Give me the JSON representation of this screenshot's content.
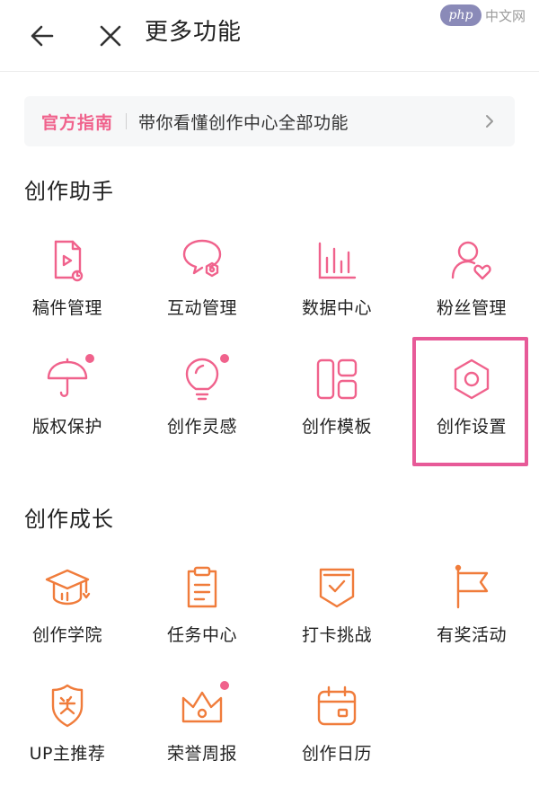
{
  "header": {
    "title": "更多功能"
  },
  "watermark": {
    "logo": "php",
    "text": "中文网"
  },
  "guide": {
    "tag": "官方指南",
    "text": "带你看懂创作中心全部功能"
  },
  "colors": {
    "pink": "#f0628c",
    "orange": "#f07c3b",
    "highlight": "#e75a98"
  },
  "sections": [
    {
      "title": "创作助手",
      "items": [
        {
          "label": "稿件管理",
          "icon": "manuscript-icon",
          "dot": false
        },
        {
          "label": "互动管理",
          "icon": "interaction-icon",
          "dot": false
        },
        {
          "label": "数据中心",
          "icon": "data-chart-icon",
          "dot": false
        },
        {
          "label": "粉丝管理",
          "icon": "fans-icon",
          "dot": false
        },
        {
          "label": "版权保护",
          "icon": "umbrella-icon",
          "dot": true
        },
        {
          "label": "创作灵感",
          "icon": "lightbulb-icon",
          "dot": true
        },
        {
          "label": "创作模板",
          "icon": "template-icon",
          "dot": false
        },
        {
          "label": "创作设置",
          "icon": "settings-hexagon-icon",
          "dot": false
        }
      ]
    },
    {
      "title": "创作成长",
      "items": [
        {
          "label": "创作学院",
          "icon": "graduation-cap-icon",
          "dot": false
        },
        {
          "label": "任务中心",
          "icon": "clipboard-icon",
          "dot": false
        },
        {
          "label": "打卡挑战",
          "icon": "shield-check-icon",
          "dot": false
        },
        {
          "label": "有奖活动",
          "icon": "flag-icon",
          "dot": false
        },
        {
          "label": "UP主推荐",
          "icon": "award-badge-icon",
          "dot": false
        },
        {
          "label": "荣誉周报",
          "icon": "crown-icon",
          "dot": true
        },
        {
          "label": "创作日历",
          "icon": "calendar-icon",
          "dot": false
        }
      ]
    }
  ]
}
